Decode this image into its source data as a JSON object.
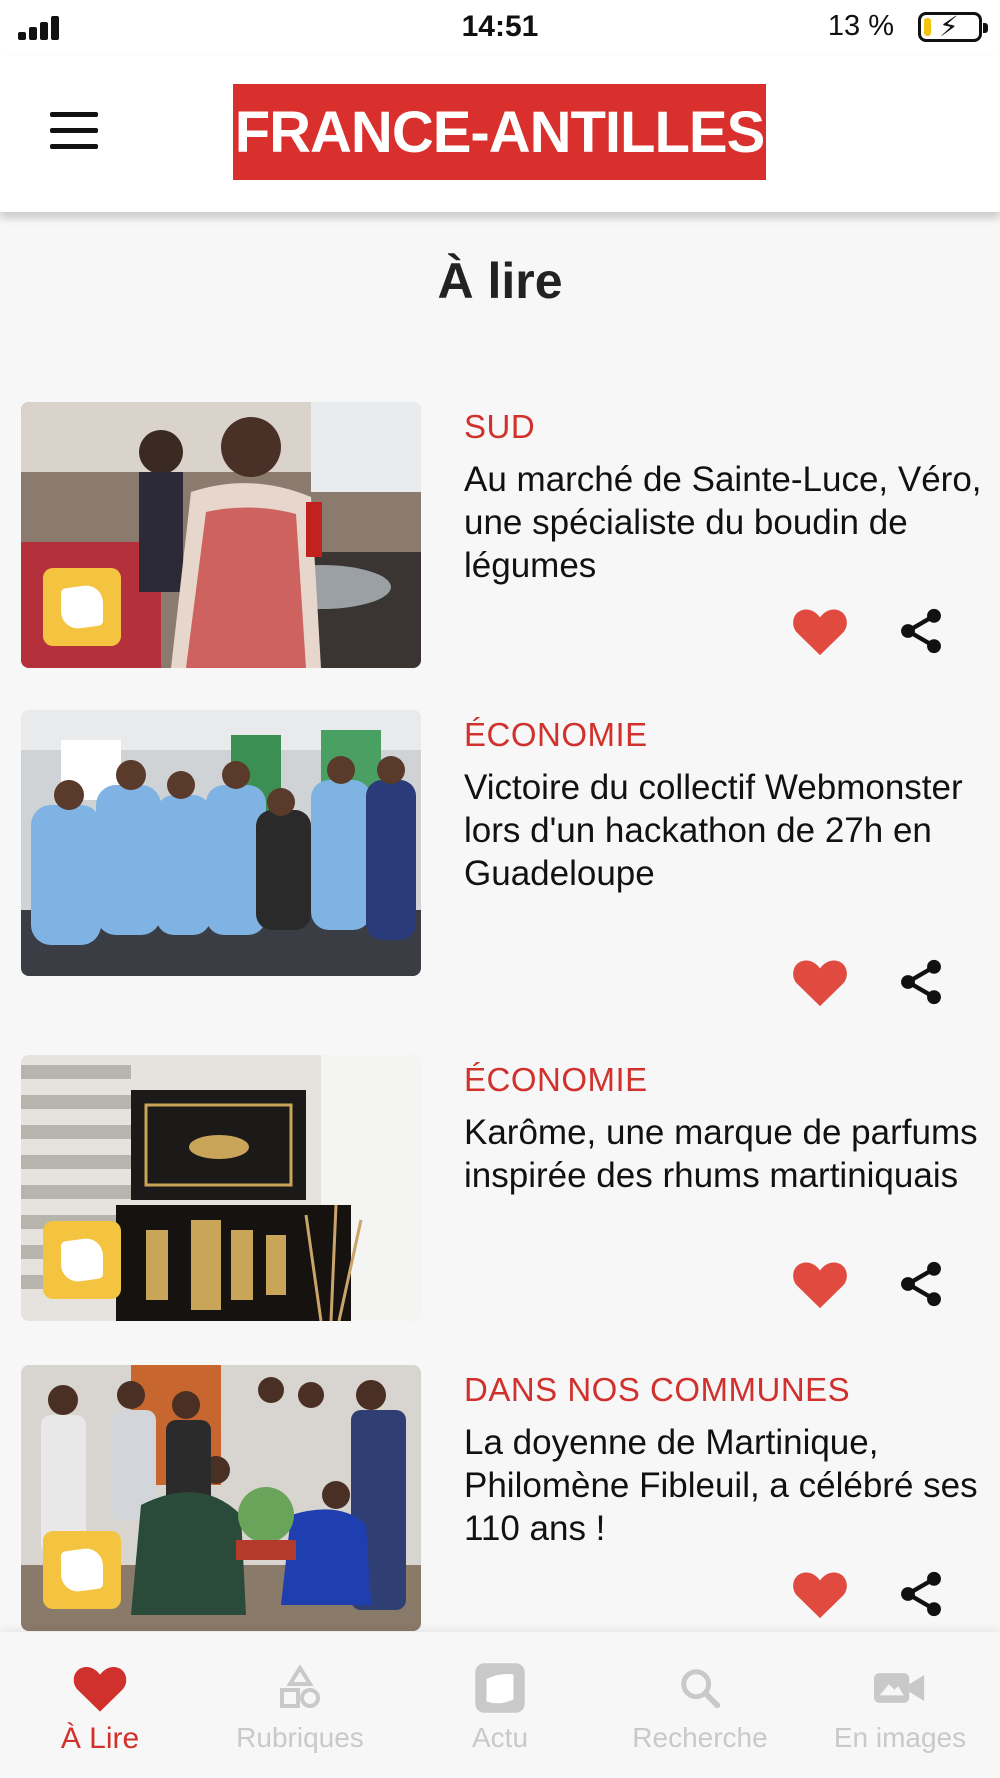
{
  "status_bar": {
    "time": "14:51",
    "battery_percent": "13 %",
    "battery_level": 0.13,
    "charging": true,
    "icons": [
      "cellular-signal-icon",
      "battery-charging-icon"
    ]
  },
  "header": {
    "menu_icon": "hamburger-menu-icon",
    "logo_text": "FRANCE-ANTILLES",
    "brand_color": "#d9302e"
  },
  "page": {
    "title": "À lire"
  },
  "articles": [
    {
      "category": "SUD",
      "title": "Au marché de Sainte-Luce, Véro, une spécialiste du boudin de légumes",
      "has_badge": true,
      "liked": true
    },
    {
      "category": "ÉCONOMIE",
      "title": "Victoire du collectif Webmonster lors d'un hackathon de 27h en Guadeloupe",
      "has_badge": false,
      "liked": true
    },
    {
      "category": "ÉCONOMIE",
      "title": "Karôme, une marque de parfums inspirée des rhums martiniquais",
      "has_badge": true,
      "liked": true
    },
    {
      "category": "DANS NOS COMMUNES",
      "title": "La doyenne de Martinique, Philomène Fibleuil, a célébré ses 110 ans !",
      "has_badge": true,
      "liked": true
    }
  ],
  "bottom_nav": {
    "items": [
      {
        "label": "À Lire",
        "icon": "heart-icon",
        "active": true
      },
      {
        "label": "Rubriques",
        "icon": "shapes-icon",
        "active": false
      },
      {
        "label": "Actu",
        "icon": "news-icon",
        "active": false
      },
      {
        "label": "Recherche",
        "icon": "search-icon",
        "active": false
      },
      {
        "label": "En images",
        "icon": "video-camera-icon",
        "active": false
      }
    ]
  },
  "colors": {
    "accent": "#d0312d",
    "heart": "#e04a3f",
    "badge": "#f4c441",
    "inactive_nav": "#c9c9c9",
    "background": "#f7f7f7"
  }
}
